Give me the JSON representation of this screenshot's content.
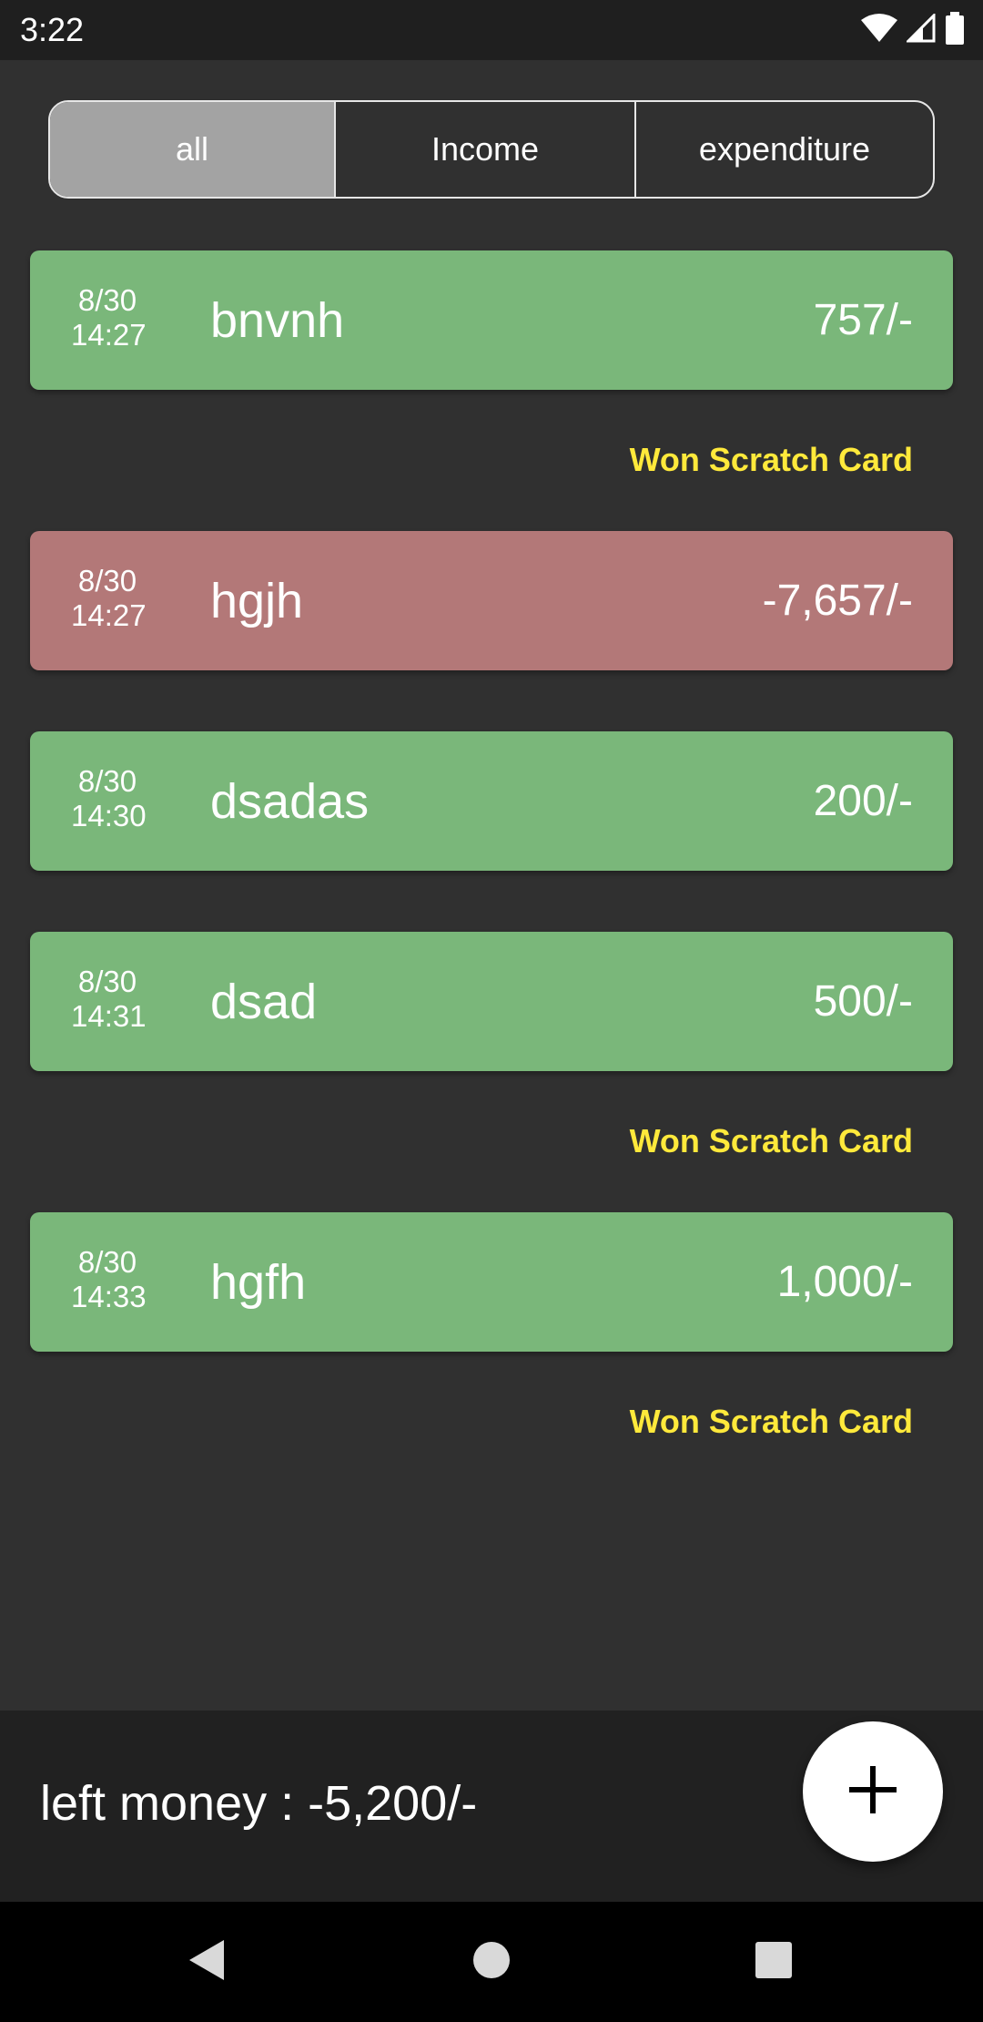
{
  "status_bar": {
    "time": "3:22",
    "icons": [
      "wifi-icon",
      "signal-icon",
      "battery-icon"
    ]
  },
  "filter_tabs": {
    "items": [
      {
        "label": "all",
        "active": true
      },
      {
        "label": "Income",
        "active": false
      },
      {
        "label": "expenditure",
        "active": false
      }
    ]
  },
  "transactions": [
    {
      "date": "8/30",
      "time": "14:27",
      "name": "bnvnh",
      "amount": "757/-",
      "type": "income",
      "badge": "Won Scratch Card"
    },
    {
      "date": "8/30",
      "time": "14:27",
      "name": "hgjh",
      "amount": "-7,657/-",
      "type": "expense",
      "badge": ""
    },
    {
      "date": "8/30",
      "time": "14:30",
      "name": "dsadas",
      "amount": "200/-",
      "type": "income",
      "badge": ""
    },
    {
      "date": "8/30",
      "time": "14:31",
      "name": "dsad",
      "amount": "500/-",
      "type": "income",
      "badge": "Won Scratch Card"
    },
    {
      "date": "8/30",
      "time": "14:33",
      "name": "hgfh",
      "amount": "1,000/-",
      "type": "income",
      "badge": "Won Scratch Card"
    }
  ],
  "footer": {
    "left_money": "left money : -5,200/-",
    "fab_icon": "plus-icon"
  },
  "colors": {
    "income_card": "#7ab77a",
    "expense_card": "#b37878",
    "badge_text": "#ffe93b",
    "background": "#303030"
  }
}
